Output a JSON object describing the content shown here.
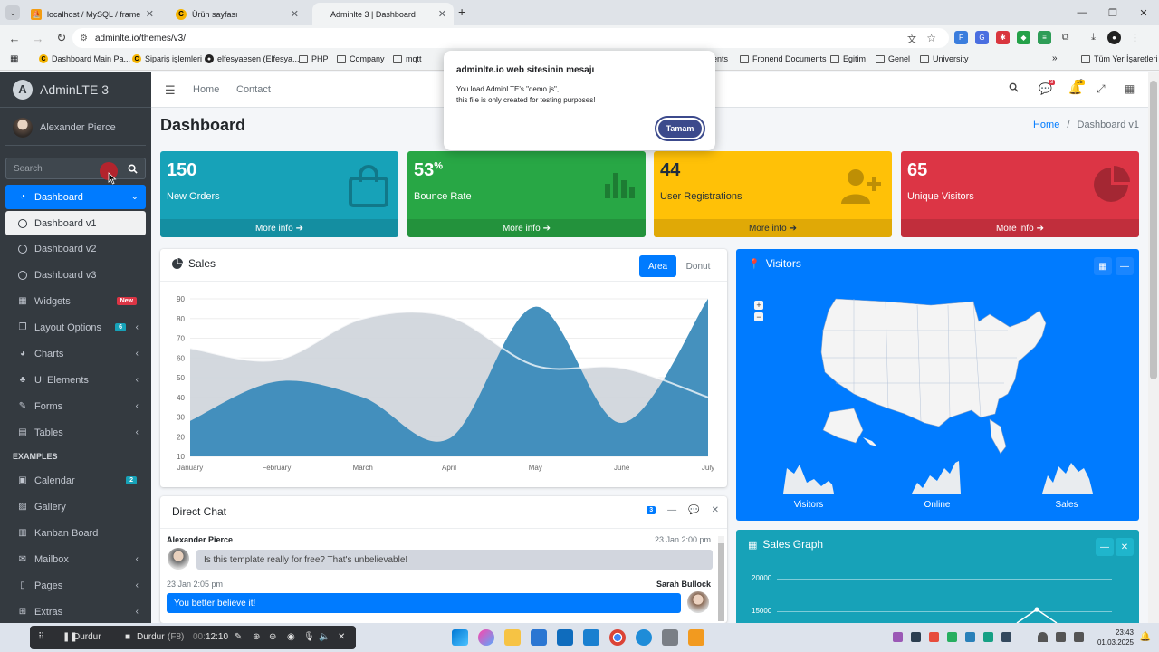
{
  "browser": {
    "tabs": [
      {
        "title": "localhost / MySQL / frame / pro",
        "active": false
      },
      {
        "title": "Ürün sayfası",
        "active": false
      },
      {
        "title": "Adminlte 3 | Dashboard",
        "active": true
      }
    ],
    "new_tab": "+",
    "url": "adminlte.io/themes/v3/",
    "bookmarks": [
      "Dashboard Main Pa...",
      "Sipariş işlemleri",
      "elfesyaesen (Elfesya...",
      "PHP",
      "Company",
      "mqtt",
      "ents",
      "Fronend Documents",
      "Egitim",
      "Genel",
      "University"
    ],
    "all_bookmarks": "Tüm Yer İşaretleri"
  },
  "sidebar": {
    "brand": "AdminLTE 3",
    "brand_letter": "A",
    "user": "Alexander Pierce",
    "search_placeholder": "Search",
    "menu": [
      {
        "label": "Dashboard",
        "state": "active"
      },
      {
        "label": "Dashboard v1",
        "state": "sub-active"
      },
      {
        "label": "Dashboard v2",
        "state": "sub"
      },
      {
        "label": "Dashboard v3",
        "state": "sub"
      },
      {
        "label": "Widgets",
        "badge": "New"
      },
      {
        "label": "Layout Options",
        "badge": "6"
      },
      {
        "label": "Charts"
      },
      {
        "label": "UI Elements"
      },
      {
        "label": "Forms"
      },
      {
        "label": "Tables"
      }
    ],
    "examples_header": "EXAMPLES",
    "examples": [
      {
        "label": "Calendar",
        "badge": "2"
      },
      {
        "label": "Gallery"
      },
      {
        "label": "Kanban Board"
      },
      {
        "label": "Mailbox"
      },
      {
        "label": "Pages"
      },
      {
        "label": "Extras"
      }
    ]
  },
  "topnav": {
    "home": "Home",
    "contact": "Contact",
    "messages_count": "3",
    "notifications_count": "15"
  },
  "header": {
    "title": "Dashboard",
    "breadcrumb_home": "Home",
    "breadcrumb_sep": "/",
    "breadcrumb_current": "Dashboard v1"
  },
  "stats": [
    {
      "value": "150",
      "suffix": "",
      "label": "New Orders",
      "footer": "More info",
      "color": "#17a2b8"
    },
    {
      "value": "53",
      "suffix": "%",
      "label": "Bounce Rate",
      "footer": "More info",
      "color": "#28a745"
    },
    {
      "value": "44",
      "suffix": "",
      "label": "User Registrations",
      "footer": "More info",
      "color": "#ffc107"
    },
    {
      "value": "65",
      "suffix": "",
      "label": "Unique Visitors",
      "footer": "More info",
      "color": "#dc3545"
    }
  ],
  "sales": {
    "title": "Sales",
    "tab_area": "Area",
    "tab_donut": "Donut"
  },
  "chart_data": {
    "type": "area",
    "categories": [
      "January",
      "February",
      "March",
      "April",
      "May",
      "June",
      "July"
    ],
    "yticks": [
      10,
      20,
      30,
      40,
      50,
      60,
      70,
      80,
      90
    ],
    "ylim": [
      10,
      90
    ],
    "series": [
      {
        "values": [
          65,
          59,
          80,
          81,
          56,
          55,
          40
        ],
        "color": "#ced4da"
      },
      {
        "values": [
          28,
          48,
          40,
          19,
          86,
          27,
          90
        ],
        "color": "#3b8bba"
      }
    ]
  },
  "chat": {
    "title": "Direct Chat",
    "count": "3",
    "messages": [
      {
        "name": "Alexander Pierce",
        "time": "23 Jan 2:00 pm",
        "text": "Is this template really for free? That's unbelievable!"
      },
      {
        "name": "Sarah Bullock",
        "time": "23 Jan 2:05 pm",
        "text": "You better believe it!"
      }
    ]
  },
  "visitors": {
    "title": "Visitors",
    "labels": [
      "Visitors",
      "Online",
      "Sales"
    ]
  },
  "sales_graph": {
    "title": "Sales Graph",
    "ticks": [
      "20000",
      "15000"
    ]
  },
  "dialog": {
    "title": "adminlte.io web sitesinin mesajı",
    "line1": "You load AdminLTE's \"demo.js\",",
    "line2": "this file is only created for testing purposes!",
    "button": "Tamam"
  },
  "taskbar": {
    "stop1": "Durdur",
    "stop2": "Durdur",
    "shortcut": "(F8)",
    "timer_prefix": "00:",
    "timer": "12:10",
    "time": "23:43",
    "date": "01.03.2025"
  }
}
